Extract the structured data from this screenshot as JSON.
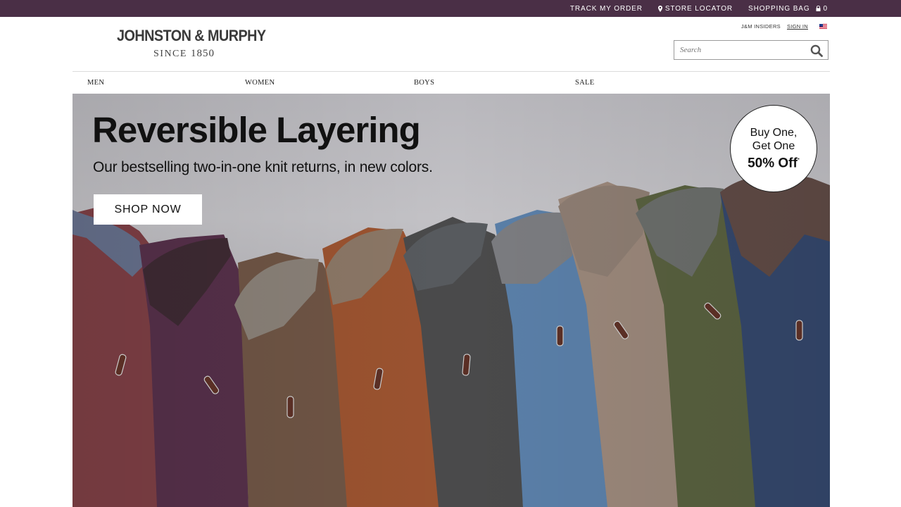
{
  "topbar": {
    "track_order": "TRACK MY ORDER",
    "store_locator": "STORE LOCATOR",
    "shopping_bag": "SHOPPING BAG",
    "bag_count": "0"
  },
  "header": {
    "logo_brand": "JOHNSTON & MURPHY",
    "logo_since": "SINCE",
    "logo_year": "1850",
    "insiders": "J&M INSIDERS",
    "sign_in": "SIGN IN",
    "search_placeholder": "Search"
  },
  "nav": {
    "items": [
      {
        "label": "MEN"
      },
      {
        "label": "WOMEN"
      },
      {
        "label": "BOYS"
      },
      {
        "label": "SALE"
      }
    ]
  },
  "hero": {
    "title": "Reversible Layering",
    "subtitle": "Our bestselling two-in-one knit returns, in new colors.",
    "cta": "SHOP NOW",
    "promo_line1": "Buy One,",
    "promo_line2": "Get One",
    "promo_line3": "50% Off",
    "promo_asterisk": "*"
  },
  "colors": {
    "topbar_bg": "#4a2f46",
    "hero_bg": "#bdbcc1"
  },
  "icons": {
    "store": "map-pin-icon",
    "bag": "lock-icon",
    "search": "magnifier-icon",
    "flag": "us-flag-icon"
  }
}
